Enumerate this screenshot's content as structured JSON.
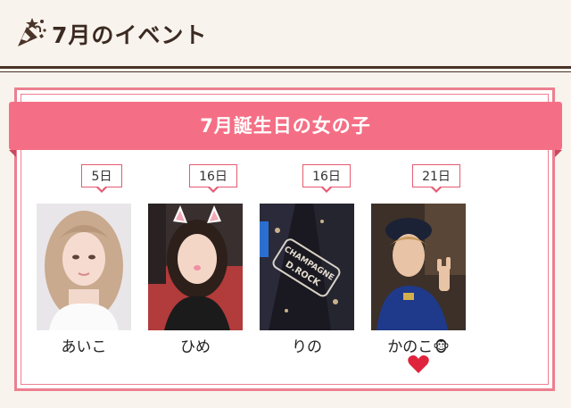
{
  "header": {
    "title": "7月のイベント",
    "icon": "party-popper-icon"
  },
  "section": {
    "title": "7月誕生日の女の子"
  },
  "members": [
    {
      "day": "5日",
      "name": "あいこ"
    },
    {
      "day": "16日",
      "name": "ひめ"
    },
    {
      "day": "16日",
      "name": "りの",
      "photo_text": [
        "CHAMPAGNE",
        "D.ROCK"
      ]
    },
    {
      "day": "21日",
      "name": "かのこ",
      "name_emoji": "🐵",
      "extra_icon": "heart-icon"
    }
  ],
  "colors": {
    "background": "#f8f3ec",
    "accent_pink": "#f46f85",
    "border_pink": "#ec7f90",
    "header_text": "#3b2a22"
  }
}
